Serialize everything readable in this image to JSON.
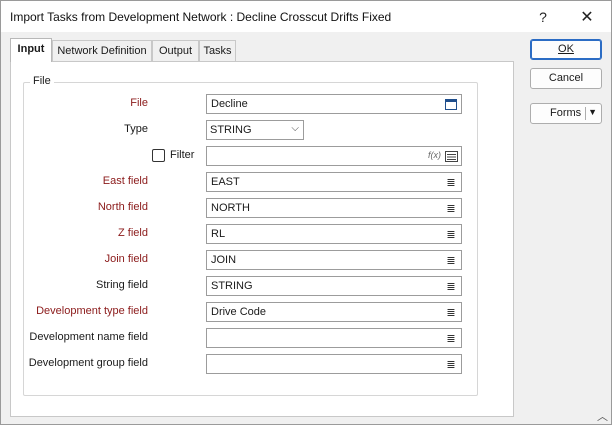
{
  "window": {
    "title": "Import Tasks from Development Network : Decline Crosscut Drifts Fixed",
    "help_glyph": "?",
    "close_glyph": "✕"
  },
  "tabs": [
    {
      "label": "Input",
      "active": true
    },
    {
      "label": "Network Definition",
      "active": false
    },
    {
      "label": "Output",
      "active": false
    },
    {
      "label": "Tasks",
      "active": false
    }
  ],
  "group": {
    "title": "File"
  },
  "form": {
    "file": {
      "label": "File",
      "value": "Decline",
      "required": true
    },
    "type": {
      "label": "Type",
      "value": "STRING"
    },
    "filter": {
      "label": "Filter",
      "checked": false,
      "value": "",
      "fx_glyph": "f(x)"
    },
    "east": {
      "label": "East field",
      "value": "EAST",
      "required": true
    },
    "north": {
      "label": "North field",
      "value": "NORTH",
      "required": true
    },
    "z": {
      "label": "Z field",
      "value": "RL",
      "required": true
    },
    "join": {
      "label": "Join field",
      "value": "JOIN",
      "required": true
    },
    "string": {
      "label": "String field",
      "value": "STRING",
      "required": false
    },
    "dev_type": {
      "label": "Development type field",
      "value": "Drive Code",
      "required": true
    },
    "dev_name": {
      "label": "Development name field",
      "value": "",
      "required": false
    },
    "dev_group": {
      "label": "Development group field",
      "value": "",
      "required": false
    }
  },
  "buttons": {
    "ok": "OK",
    "cancel": "Cancel",
    "forms": "Forms"
  },
  "icons": {
    "list_glyph": "≣",
    "calendar_glyph": "▭",
    "chevron_glyph": "⌵",
    "caret_glyph": "▼",
    "grip_glyph": "︿"
  }
}
